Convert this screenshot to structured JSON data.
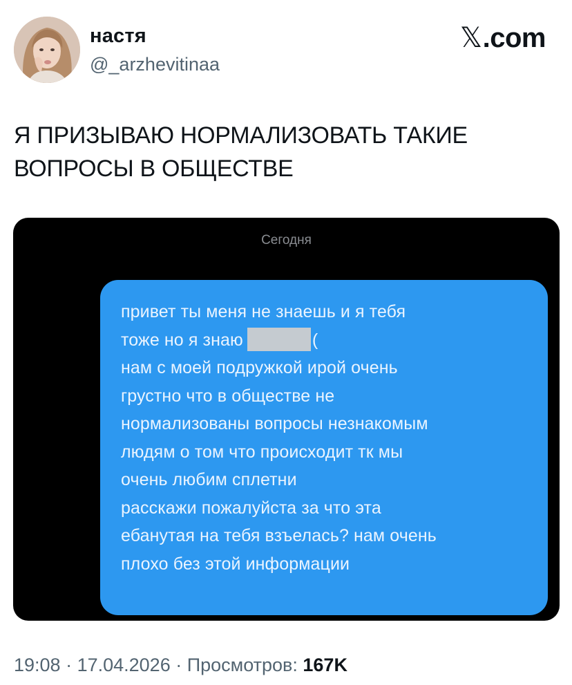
{
  "author": {
    "name": "настя",
    "handle": "@_arzhevitinaa",
    "avatar_icon": "profile-photo-avatar"
  },
  "brand": {
    "glyph": "𝕏",
    "suffix": ".com"
  },
  "tweet": {
    "text_lines": [
      "Я ПРИЗЫВАЮ НОРМАЛИЗОВАТЬ ТАКИЕ",
      "ВОПРОСЫ В ОБЩЕСТВЕ"
    ]
  },
  "screenshot": {
    "date_separator": "Сегодня",
    "bubble_color": "#2d98f0",
    "message_lines": [
      "привет ты меня не знаешь и я тебя",
      "тоже но я знаю",
      "(",
      "нам с моей подружкой ирой очень",
      "грустно что в обществе не",
      "нормализованы вопросы незнакомым",
      "людям о том что происходит тк мы",
      "очень любим сплетни",
      "расскажи пожалуйста за что эта",
      "ебанутая на тебя взъелась? нам очень",
      "плохо без этой информации"
    ]
  },
  "meta": {
    "time": "19:08",
    "sep1": " · ",
    "date": "17.04.2026",
    "sep2": " · ",
    "views_label": "Просмотров: ",
    "views_count": "167K"
  }
}
